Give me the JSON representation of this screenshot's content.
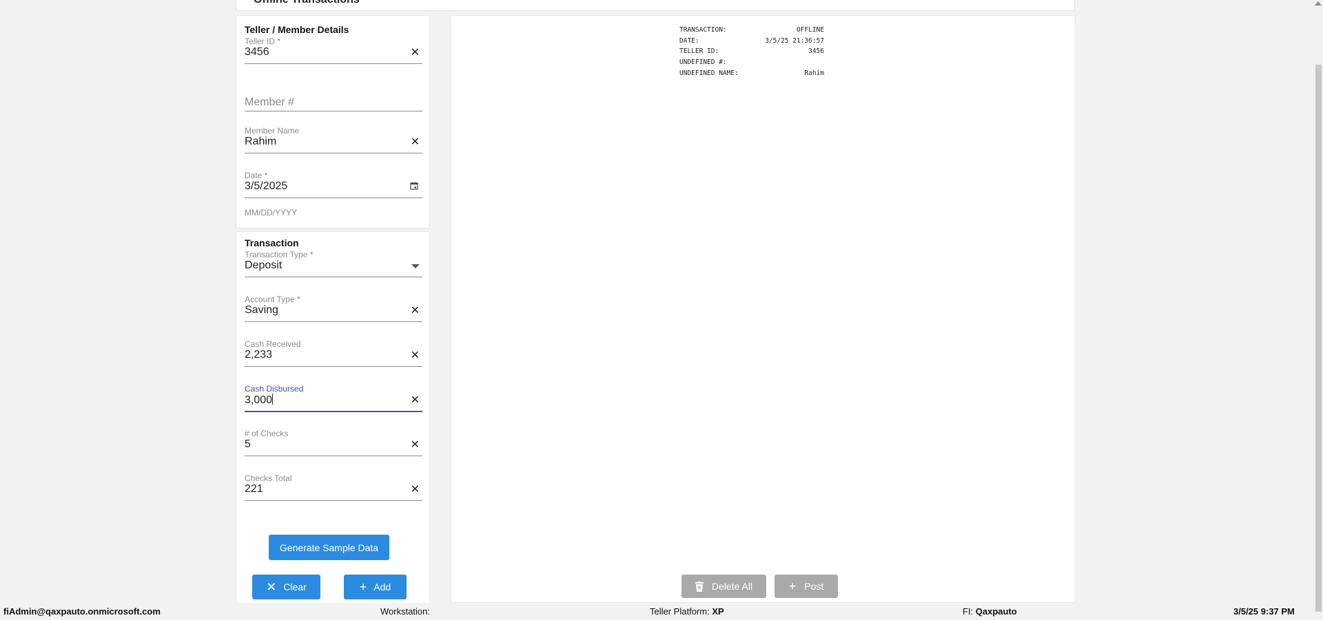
{
  "header": {
    "title": "Offline Transactions"
  },
  "member_section": {
    "title": "Teller / Member Details",
    "teller_id": {
      "label": "Teller ID *",
      "value": "3456"
    },
    "member_number": {
      "placeholder": "Member #"
    },
    "member_name": {
      "label": "Member Name",
      "value": "Rahim"
    },
    "date": {
      "label": "Date *",
      "value": "3/5/2025",
      "helper": "MM/DD/YYYY"
    }
  },
  "transaction_section": {
    "title": "Transaction",
    "transaction_type": {
      "label": "Transaction Type *",
      "value": "Deposit"
    },
    "account_type": {
      "label": "Account Type *",
      "value": "Saving"
    },
    "cash_received": {
      "label": "Cash Received",
      "value": "2,233"
    },
    "cash_disbursed": {
      "label": "Cash Disbursed",
      "value": "3,000"
    },
    "num_checks": {
      "label": "# of Checks",
      "value": "5"
    },
    "checks_total": {
      "label": "Checks Total",
      "value": "221"
    }
  },
  "buttons": {
    "generate": "Generate Sample Data",
    "clear": "Clear",
    "add": "Add",
    "delete_all": "Delete All",
    "post": "Post"
  },
  "receipt": {
    "rows": [
      {
        "label": "TRANSACTION:",
        "value": "OFFLINE"
      },
      {
        "label": "DATE:",
        "value": "3/5/25 21:36:57"
      },
      {
        "label": "TELLER ID:",
        "value": "3456"
      },
      {
        "label": "UNDEFINED #:",
        "value": ""
      },
      {
        "label": "UNDEFINED NAME:",
        "value": "Rahim"
      }
    ]
  },
  "status_bar": {
    "user": "fiAdmin@qaxpauto.onmicrosoft.com",
    "workstation_label": "Workstation:",
    "platform_label": "Teller Platform:",
    "platform_value": "XP",
    "fi_label": "FI:",
    "fi_value": "Qaxpauto",
    "datetime": "3/5/25 9:37 PM"
  },
  "icons": {
    "clear_field": "close-icon",
    "date_picker": "calendar-icon",
    "dropdown": "caret-down-icon",
    "clear_button": "close-icon",
    "add_button": "plus-icon",
    "delete_all_button": "trash-icon",
    "post_button": "plus-icon"
  },
  "colors": {
    "primary": "#2b8be0",
    "focus": "#3f51b5",
    "disabled": "#a9a9a9"
  }
}
